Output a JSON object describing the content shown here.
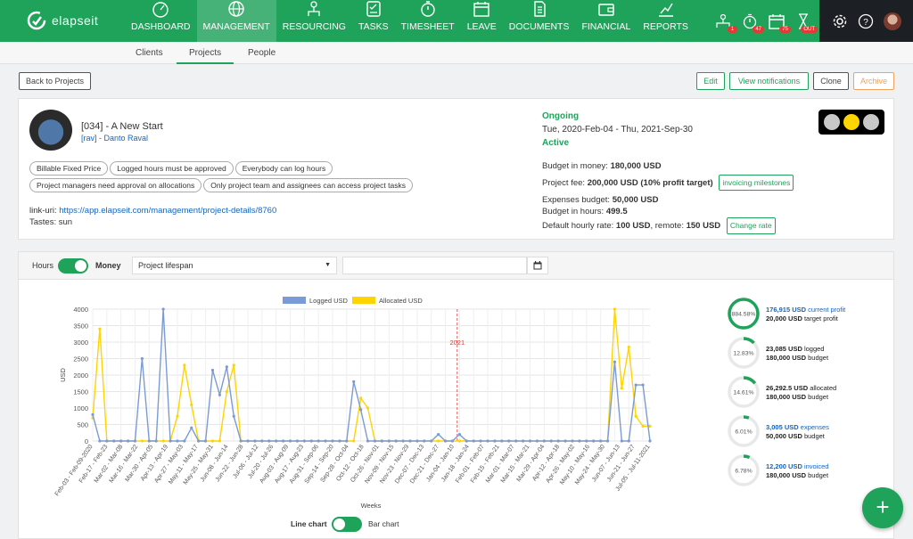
{
  "app": {
    "logo_text": "elapseit"
  },
  "nav": [
    {
      "label": "DASHBOARD",
      "icon": "dashboard-icon"
    },
    {
      "label": "MANAGEMENT",
      "icon": "globe-icon"
    },
    {
      "label": "RESOURCING",
      "icon": "people-icon"
    },
    {
      "label": "TASKS",
      "icon": "tasks-icon"
    },
    {
      "label": "TIMESHEET",
      "icon": "stopwatch-icon"
    },
    {
      "label": "LEAVE",
      "icon": "calendar-icon"
    },
    {
      "label": "DOCUMENTS",
      "icon": "document-icon"
    },
    {
      "label": "FINANCIAL",
      "icon": "wallet-icon"
    },
    {
      "label": "REPORTS",
      "icon": "chart-icon"
    }
  ],
  "notifications": [
    {
      "icon": "team-icon",
      "count": "1"
    },
    {
      "icon": "timer-icon",
      "count": "47"
    },
    {
      "icon": "calendar-icon",
      "count": "75"
    },
    {
      "icon": "hourglass-icon",
      "count": "OUT"
    }
  ],
  "subnav": {
    "clients": "Clients",
    "projects": "Projects",
    "people": "People"
  },
  "actions": {
    "back": "Back to Projects",
    "edit": "Edit",
    "view_notifications": "View notifications",
    "clone": "Clone",
    "archive": "Archive"
  },
  "project": {
    "title": "[034] - A New Start",
    "manager": "[rav] - Danto Raval",
    "tags": [
      "Billable Fixed Price",
      "Logged hours must be approved",
      "Everybody can log hours",
      "Project managers need approval on allocations",
      "Only project team and assignees can access project tasks"
    ],
    "link_label": "link-uri:",
    "link_url": "https://app.elapseit.com/management/project-details/8760",
    "tastes": "Tastes: sun",
    "status": "Ongoing",
    "dates": "Tue, 2020-Feb-04 - Thu, 2021-Sep-30",
    "state": "Active",
    "budget_money_label": "Budget in money:",
    "budget_money": "180,000 USD",
    "fee_label": "Project fee:",
    "fee": "200,000 USD (10% profit target)",
    "invoicing_milestones": "invoicing milestones",
    "expenses_label": "Expenses budget:",
    "expenses": "50,000 USD",
    "hours_label": "Budget in hours:",
    "hours": "499.5",
    "rate_label": "Default hourly rate:",
    "rate": "100 USD",
    "remote_label": ", remote:",
    "remote": "150 USD",
    "change_rate": "Change rate",
    "traffic_light_colors": [
      "#c8c8c8",
      "#ffd500",
      "#c8c8c8"
    ]
  },
  "toolbar": {
    "hours": "Hours",
    "money": "Money",
    "period": "Project lifespan",
    "date_placeholder": ""
  },
  "chart_data": {
    "type": "line",
    "title": "",
    "xlabel": "Weeks",
    "ylabel": "USD",
    "ylim": [
      0,
      4000
    ],
    "yticks": [
      "4000",
      "3500",
      "3000",
      "2500",
      "2000",
      "1500",
      "1000",
      "500",
      "0"
    ],
    "annotation": "2021",
    "legend_position": "top-center",
    "x_tick_labels": [
      "Feb-03 - Feb-09-2020",
      "Feb-17 - Feb-23",
      "Mar-02 - Mar-08",
      "Mar-16 - Mar-22",
      "Mar-30 - Apr-05",
      "Apr-13 - Apr-19",
      "Apr-27 - May-03",
      "May-11 - May-17",
      "May-25 - May-31",
      "Jun-08 - Jun-14",
      "Jun-22 - Jun-28",
      "Jul-06 - Jul-12",
      "Jul-20 - Jul-26",
      "Aug-03 - Aug-09",
      "Aug-17 - Aug-23",
      "Aug-31 - Sep-06",
      "Sep-14 - Sep-20",
      "Sep-28 - Oct-04",
      "Oct-12 - Oct-18",
      "Oct-26 - Nov-01",
      "Nov-09 - Nov-15",
      "Nov-23 - Nov-29",
      "Dec-07 - Dec-13",
      "Dec-21 - Dec-27",
      "Jan-04 - Jan-10",
      "Jan-18 - Jan-24",
      "Feb-01 - Feb-07",
      "Feb-15 - Feb-21",
      "Mar-01 - Mar-07",
      "Mar-15 - Mar-21",
      "Mar-29 - Apr-04",
      "Apr-12 - Apr-18",
      "Apr-26 - May-02",
      "May-10 - May-16",
      "May-24 - May-30",
      "Jun-07 - Jun-13",
      "Jun-21 - Jun-27",
      "Jul-05 - Jul-11-2021"
    ],
    "series": [
      {
        "name": "Logged USD",
        "color": "#7b9bd6",
        "values": [
          800,
          0,
          0,
          0,
          0,
          0,
          0,
          2500,
          0,
          0,
          4000,
          0,
          0,
          0,
          400,
          0,
          0,
          2150,
          1400,
          2250,
          750,
          0,
          0,
          0,
          0,
          0,
          0,
          0,
          0,
          0,
          0,
          0,
          0,
          0,
          0,
          0,
          0,
          1800,
          950,
          0,
          0,
          0,
          0,
          0,
          0,
          0,
          0,
          0,
          0,
          200,
          0,
          0,
          200,
          0,
          0,
          0,
          0,
          0,
          0,
          0,
          0,
          0,
          0,
          0,
          0,
          0,
          0,
          0,
          0,
          0,
          0,
          0,
          0,
          0,
          2400,
          0,
          0,
          1700,
          1700,
          0
        ]
      },
      {
        "name": "Allocated USD",
        "color": "#ffd400",
        "values": [
          700,
          3400,
          0,
          0,
          0,
          0,
          0,
          0,
          0,
          0,
          0,
          0,
          750,
          2300,
          1100,
          0,
          0,
          0,
          0,
          1500,
          2300,
          0,
          0,
          0,
          0,
          0,
          0,
          0,
          0,
          0,
          0,
          0,
          0,
          0,
          0,
          0,
          0,
          0,
          1300,
          1000,
          0,
          0,
          0,
          0,
          0,
          0,
          0,
          0,
          0,
          0,
          0,
          0,
          0,
          0,
          0,
          0,
          0,
          0,
          0,
          0,
          0,
          0,
          0,
          0,
          0,
          0,
          0,
          0,
          0,
          0,
          0,
          0,
          0,
          0,
          4000,
          1600,
          2850,
          750,
          450,
          450
        ]
      }
    ]
  },
  "chart_toggle": {
    "line": "Line chart",
    "bar": "Bar chart"
  },
  "summary": [
    {
      "pct": "884.58%",
      "fraction": 1.0,
      "color": "#1fa25a",
      "value": "176,915 USD",
      "value_label": " current profit",
      "highlight": true,
      "sub": "20,000 USD",
      "sub_label": " target profit"
    },
    {
      "pct": "12.83%",
      "fraction": 0.1283,
      "color": "#1fa25a",
      "value": "23,085 USD",
      "value_label": " logged",
      "highlight": false,
      "sub": "180,000 USD",
      "sub_label": " budget"
    },
    {
      "pct": "14.61%",
      "fraction": 0.1461,
      "color": "#1fa25a",
      "value": "26,292.5 USD",
      "value_label": " allocated",
      "highlight": false,
      "sub": "180,000 USD",
      "sub_label": " budget"
    },
    {
      "pct": "6.01%",
      "fraction": 0.0601,
      "color": "#1fa25a",
      "value": "3,005 USD",
      "value_label": " expenses",
      "highlight": true,
      "sub": "50,000 USD",
      "sub_label": " budget"
    },
    {
      "pct": "6.78%",
      "fraction": 0.0678,
      "color": "#1fa25a",
      "value": "12,200 USD",
      "value_label": " invoiced",
      "highlight": true,
      "sub": "180,000 USD",
      "sub_label": " budget"
    }
  ],
  "fab_label": "+"
}
